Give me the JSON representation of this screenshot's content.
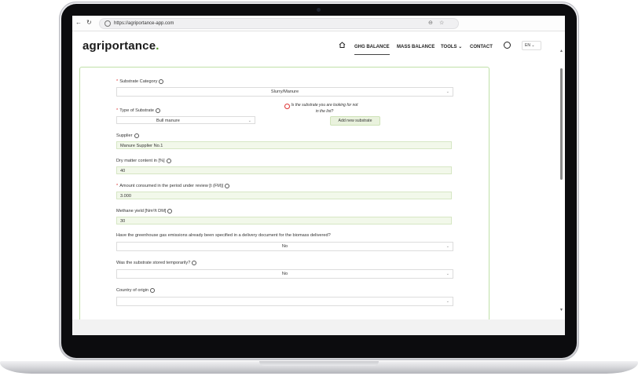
{
  "browser": {
    "url": "https://agriportance-app.com",
    "back_glyph": "←",
    "reload_glyph": "↻",
    "zoom_glyph": "⊖",
    "star_glyph": "☆"
  },
  "header": {
    "logo_text": "agriportance",
    "logo_dot": ".",
    "nav": [
      {
        "label": "GHG BALANCE"
      },
      {
        "label": "MASS BALANCE"
      },
      {
        "label": "TOOLS ⌄"
      },
      {
        "label": "CONTACT"
      }
    ],
    "language": "EN ⌄"
  },
  "form": {
    "substrate_category": {
      "label": "Substrate Category",
      "value": "Slurry/Manure"
    },
    "type_of_substrate": {
      "label": "Type of Substrate",
      "value": "Bull manure"
    },
    "not_in_list": {
      "text": "Is the substrate you are looking for not in the list?",
      "button": "Add new substrate"
    },
    "supplier": {
      "label": "Supplier",
      "value": "Manure Supplier No.1"
    },
    "dry_matter": {
      "label": "Dry matter content in [%]",
      "value": "40"
    },
    "amount_consumed": {
      "label": "Amount consumed in the period under review [t (FM)]",
      "value": "3.000"
    },
    "methane_yield": {
      "label": "Methane yield [Nm³/t DM]",
      "value": "30"
    },
    "ghg_specified": {
      "label": "Have the greenhouse gas emissions already been specified in a delivery document for the biomass delivered?",
      "value": "No"
    },
    "stored_temporarily": {
      "label": "Was the substrate stored temporarily?",
      "value": "No"
    },
    "country_of_origin": {
      "label": "Country of origin"
    }
  },
  "colors": {
    "accent_green": "#5a9e2e",
    "card_border": "#bfe0a8",
    "required": "#d33333"
  }
}
